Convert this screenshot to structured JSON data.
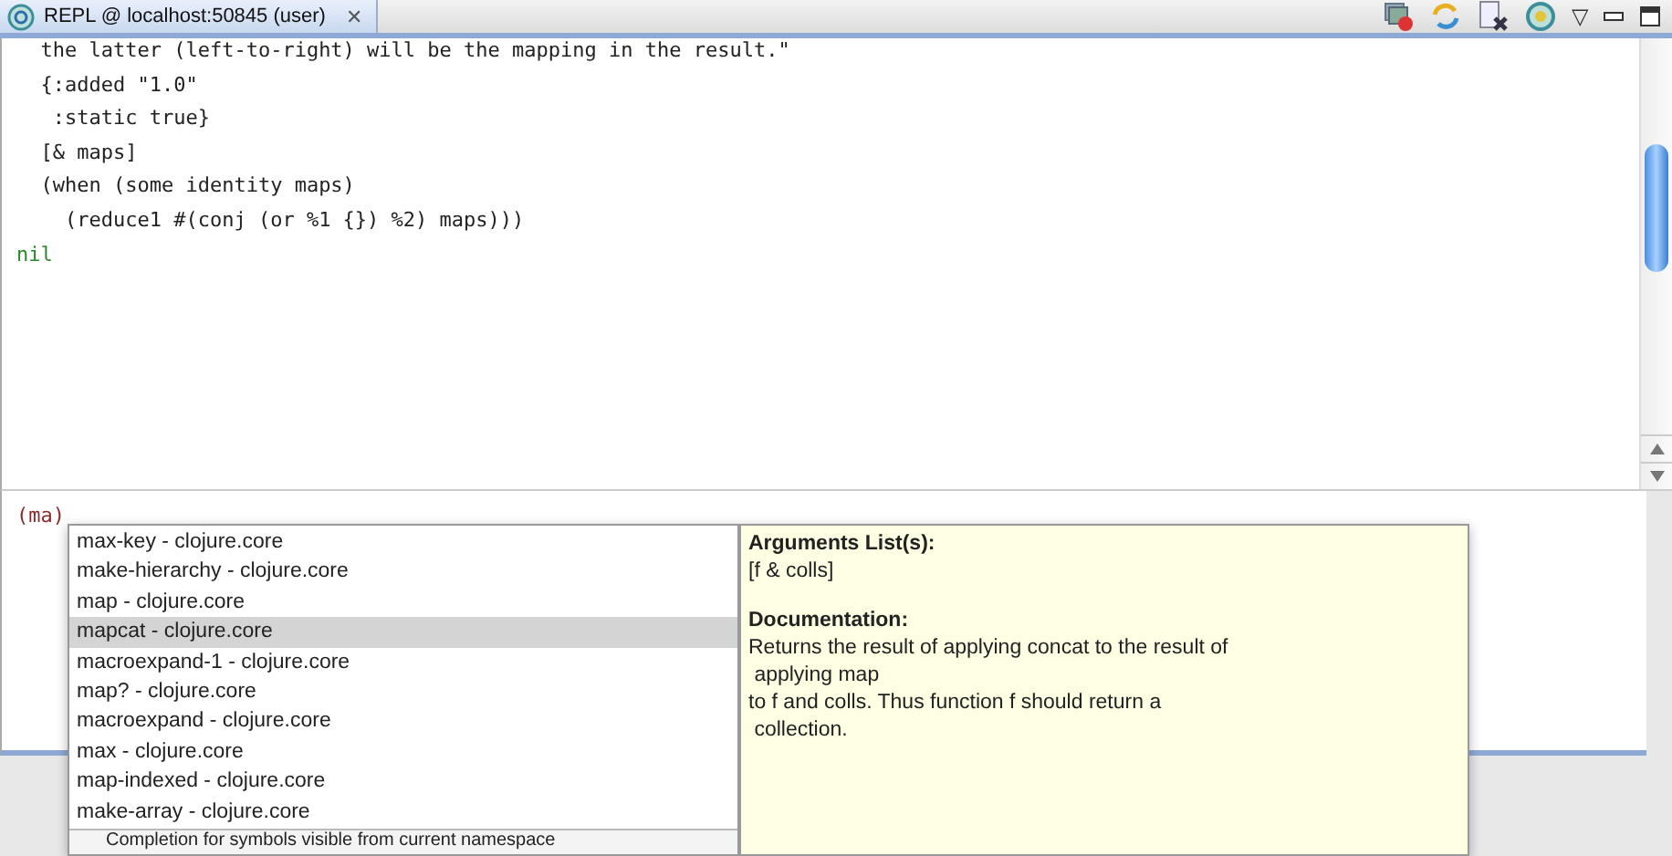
{
  "tab": {
    "title": "REPL @ localhost:50845 (user)",
    "close": "✕"
  },
  "toolbar": {
    "view_menu": "▽"
  },
  "output_lines": [
    {
      "kind": "code",
      "text": "  the latter (left-to-right) will be the mapping in the result.\""
    },
    {
      "kind": "code",
      "text": "  {:added \"1.0\""
    },
    {
      "kind": "code",
      "text": "   :static true}"
    },
    {
      "kind": "code",
      "text": "  [& maps]"
    },
    {
      "kind": "code",
      "text": "  (when (some identity maps)"
    },
    {
      "kind": "code",
      "text": "    (reduce1 #(conj (or %1 {}) %2) maps)))"
    },
    {
      "kind": "result",
      "text": "nil"
    }
  ],
  "input": {
    "value": "(ma)"
  },
  "completions": [
    {
      "label": "max-key - clojure.core",
      "selected": false
    },
    {
      "label": "make-hierarchy - clojure.core",
      "selected": false
    },
    {
      "label": "map - clojure.core",
      "selected": false
    },
    {
      "label": "mapcat - clojure.core",
      "selected": true
    },
    {
      "label": "macroexpand-1 - clojure.core",
      "selected": false
    },
    {
      "label": "map? - clojure.core",
      "selected": false
    },
    {
      "label": "macroexpand - clojure.core",
      "selected": false
    },
    {
      "label": "max - clojure.core",
      "selected": false
    },
    {
      "label": "map-indexed - clojure.core",
      "selected": false
    },
    {
      "label": "make-array - clojure.core",
      "selected": false
    }
  ],
  "completion_status": "Completion for symbols visible from current namespace",
  "doc": {
    "args_heading": "Arguments List(s):",
    "args": "[f & colls]",
    "doc_heading": "Documentation:",
    "doc_text": "Returns the result of applying concat to the result of\n applying map\nto f and colls. Thus function f should return a\n collection."
  }
}
